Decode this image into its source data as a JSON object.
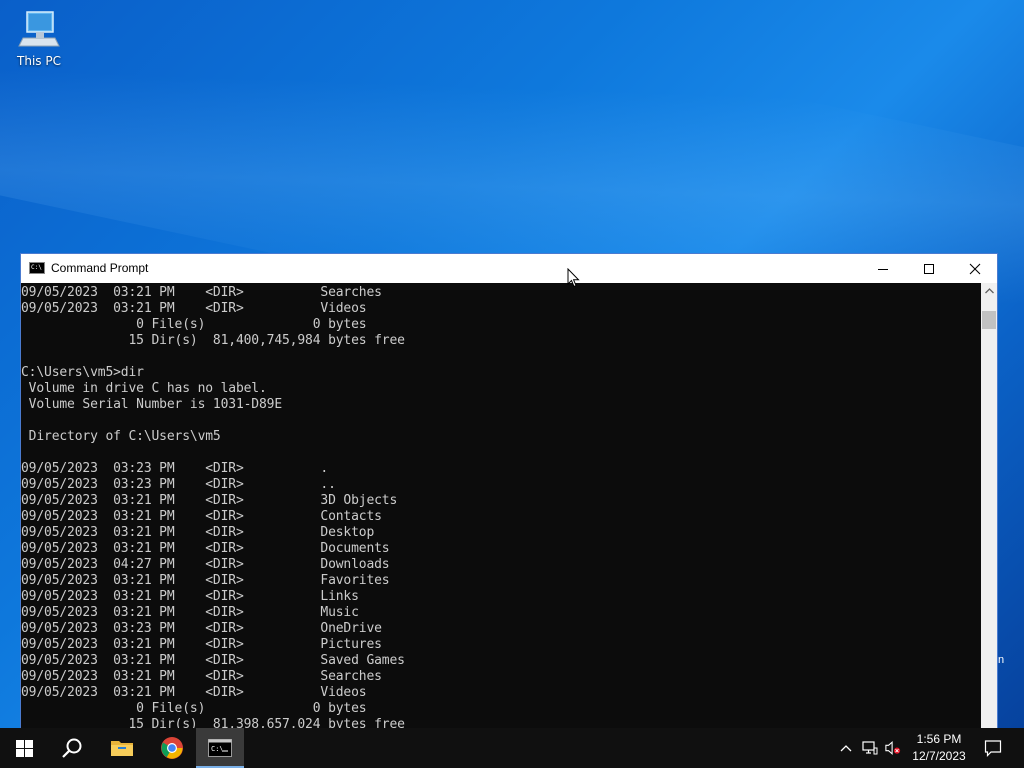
{
  "desktop": {
    "icons": [
      {
        "label": "This PC",
        "icon": "computer-icon"
      }
    ],
    "edge_fragment": "n"
  },
  "window": {
    "title": "Command Prompt",
    "icon": "cmd-icon",
    "controls": {
      "minimize": "minimize-icon",
      "maximize": "maximize-icon",
      "close": "close-icon"
    }
  },
  "console": {
    "lines": [
      "09/05/2023  03:21 PM    <DIR>          Searches",
      "09/05/2023  03:21 PM    <DIR>          Videos",
      "               0 File(s)              0 bytes",
      "              15 Dir(s)  81,400,745,984 bytes free",
      "",
      "C:\\Users\\vm5>dir",
      " Volume in drive C has no label.",
      " Volume Serial Number is 1031-D89E",
      "",
      " Directory of C:\\Users\\vm5",
      "",
      "09/05/2023  03:23 PM    <DIR>          .",
      "09/05/2023  03:23 PM    <DIR>          ..",
      "09/05/2023  03:21 PM    <DIR>          3D Objects",
      "09/05/2023  03:21 PM    <DIR>          Contacts",
      "09/05/2023  03:21 PM    <DIR>          Desktop",
      "09/05/2023  03:21 PM    <DIR>          Documents",
      "09/05/2023  04:27 PM    <DIR>          Downloads",
      "09/05/2023  03:21 PM    <DIR>          Favorites",
      "09/05/2023  03:21 PM    <DIR>          Links",
      "09/05/2023  03:21 PM    <DIR>          Music",
      "09/05/2023  03:23 PM    <DIR>          OneDrive",
      "09/05/2023  03:21 PM    <DIR>          Pictures",
      "09/05/2023  03:21 PM    <DIR>          Saved Games",
      "09/05/2023  03:21 PM    <DIR>          Searches",
      "09/05/2023  03:21 PM    <DIR>          Videos",
      "               0 File(s)              0 bytes",
      "              15 Dir(s)  81,398,657,024 bytes free"
    ]
  },
  "taskbar": {
    "start": "windows-start-icon",
    "search": "search-icon",
    "apps": [
      {
        "name": "File Explorer",
        "icon": "folder-icon"
      },
      {
        "name": "Google Chrome",
        "icon": "chrome-icon"
      },
      {
        "name": "Command Prompt",
        "icon": "cmd-icon",
        "active": true
      }
    ],
    "tray": {
      "icons": [
        "chevron-up-icon",
        "network-icon",
        "volume-muted-icon"
      ],
      "time": "1:56 PM",
      "date": "12/7/2023",
      "notifications": "notification-icon"
    }
  },
  "colors": {
    "console_bg": "#0c0c0c",
    "console_fg": "#cccccc",
    "taskbar_bg": "#101010",
    "desktop_blue": "#0e78dc"
  }
}
